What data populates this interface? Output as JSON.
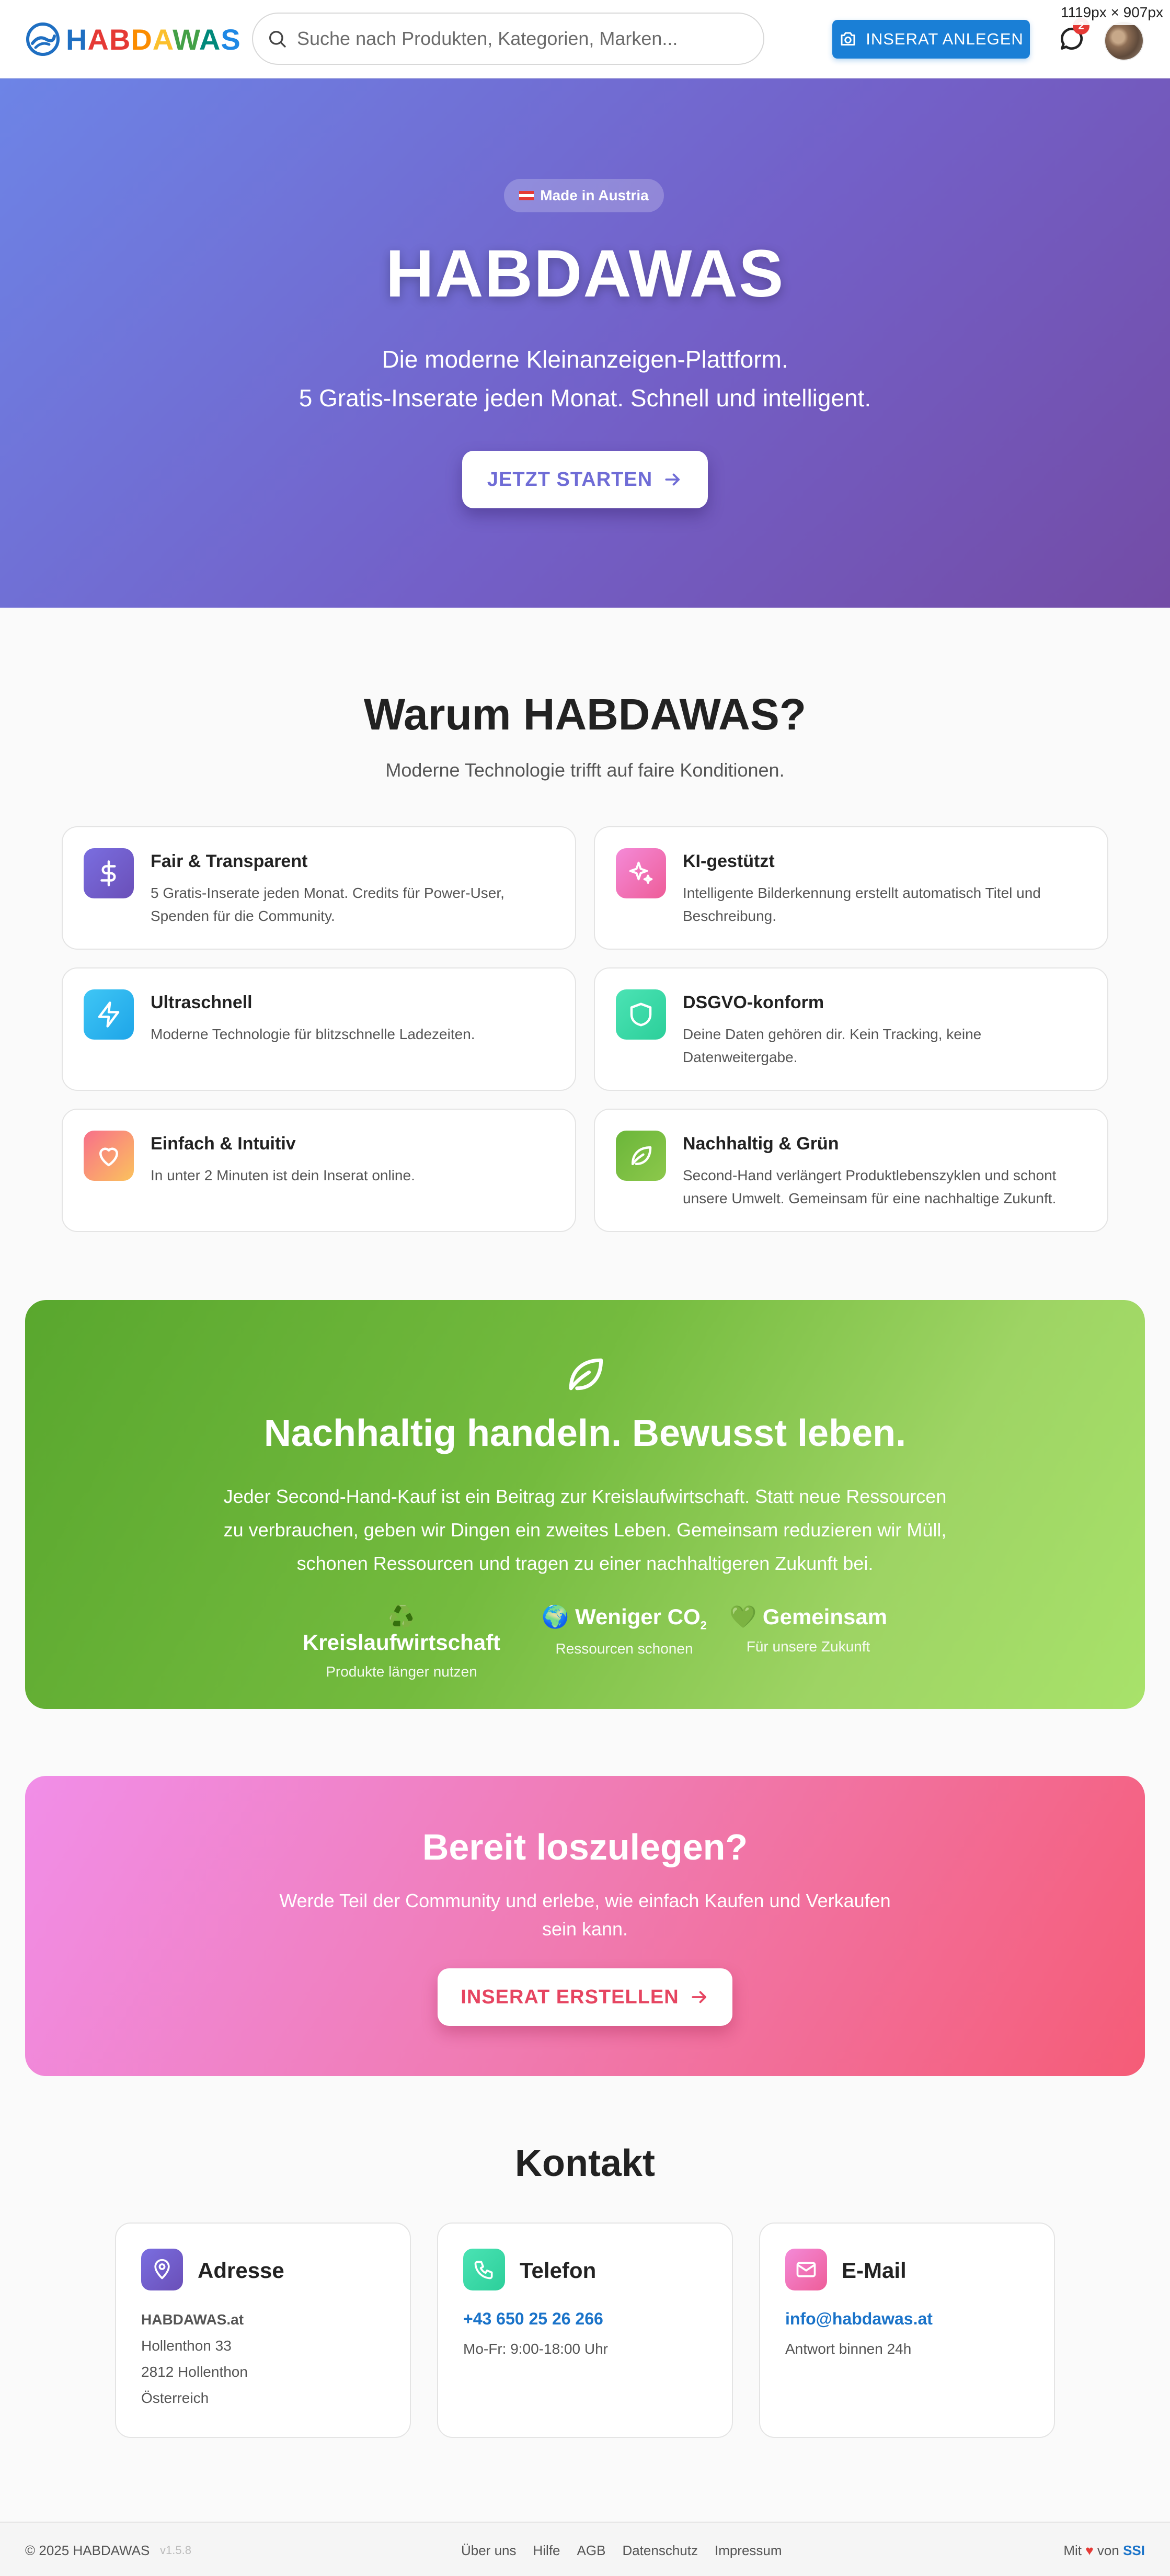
{
  "overlay": {
    "size_label": "1119px × 907px"
  },
  "header": {
    "brand": [
      "H",
      "AB",
      "D",
      "A",
      "W",
      "A",
      "S"
    ],
    "search_placeholder": "Suche nach Produkten, Kategorien, Marken...",
    "cta_label": "INSERAT ANLEGEN",
    "notification_count": "2"
  },
  "hero": {
    "badge": "Made in Austria",
    "title": "HABDAWAS",
    "subtitle_line1": "Die moderne Kleinanzeigen-Plattform.",
    "subtitle_line2": "5 Gratis-Inserate jeden Monat. Schnell und intelligent.",
    "cta": "JETZT STARTEN"
  },
  "why": {
    "title": "Warum HABDAWAS?",
    "subtitle": "Moderne Technologie trifft auf faire Konditionen.",
    "features": [
      {
        "icon": "dollar-icon",
        "title": "Fair & Transparent",
        "desc": "5 Gratis-Inserate jeden Monat. Credits für Power-User, Spenden für die Community."
      },
      {
        "icon": "sparkles-icon",
        "title": "KI-gestützt",
        "desc": "Intelligente Bilderkennung erstellt automatisch Titel und Beschreibung."
      },
      {
        "icon": "lightning-icon",
        "title": "Ultraschnell",
        "desc": "Moderne Technologie für blitzschnelle Ladezeiten."
      },
      {
        "icon": "shield-icon",
        "title": "DSGVO-konform",
        "desc": "Deine Daten gehören dir. Kein Tracking, keine Datenweitergabe."
      },
      {
        "icon": "heart-icon",
        "title": "Einfach & Intuitiv",
        "desc": "In unter 2 Minuten ist dein Inserat online."
      },
      {
        "icon": "leaf-icon",
        "title": "Nachhaltig & Grün",
        "desc": "Second-Hand verlängert Produktlebenszyklen und schont unsere Umwelt. Gemeinsam für eine nachhaltige Zukunft."
      }
    ]
  },
  "green": {
    "title": "Nachhaltig handeln. Bewusst leben.",
    "text": "Jeder Second-Hand-Kauf ist ein Beitrag zur Kreislaufwirtschaft. Statt neue Ressourcen zu verbrauchen, geben wir Dingen ein zweites Leben. Gemeinsam reduzieren wir Müll, schonen Ressourcen und tragen zu einer nachhaltigeren Zukunft bei.",
    "stats": [
      {
        "emoji": "♻️",
        "title": "Kreislaufwirtschaft",
        "sub": "Produkte länger nutzen"
      },
      {
        "emoji": "🌍",
        "title": "Weniger CO",
        "title_sub": "2",
        "sub": "Ressourcen schonen"
      },
      {
        "emoji": "💚",
        "title": "Gemeinsam",
        "sub": "Für unsere Zukunft"
      }
    ]
  },
  "pink": {
    "title": "Bereit loszulegen?",
    "text": "Werde Teil der Community und erlebe, wie einfach Kaufen und Verkaufen sein kann.",
    "cta": "INSERAT ERSTELLEN"
  },
  "contact": {
    "title": "Kontakt",
    "address": {
      "title": "Adresse",
      "name": "HABDAWAS.at",
      "street": "Hollenthon 33",
      "city": "2812 Hollenthon",
      "country": "Österreich"
    },
    "phone": {
      "title": "Telefon",
      "number": "+43 650 25 26 266",
      "hours": "Mo-Fr: 9:00-18:00 Uhr"
    },
    "email": {
      "title": "E-Mail",
      "address": "info@habdawas.at",
      "note": "Antwort binnen 24h"
    }
  },
  "footer": {
    "copyright": "© 2025 HABDAWAS",
    "version": "v1.5.8",
    "links": [
      "Über uns",
      "Hilfe",
      "AGB",
      "Datenschutz",
      "Impressum"
    ],
    "made_prefix": "Mit",
    "made_middle": "von",
    "made_by": "SSI"
  },
  "colors": {
    "primary": "#1a7fd6",
    "hero_start": "#6d84e6",
    "hero_end": "#734ca6",
    "green": "#74bb3e",
    "pink": "#f07ab0"
  }
}
